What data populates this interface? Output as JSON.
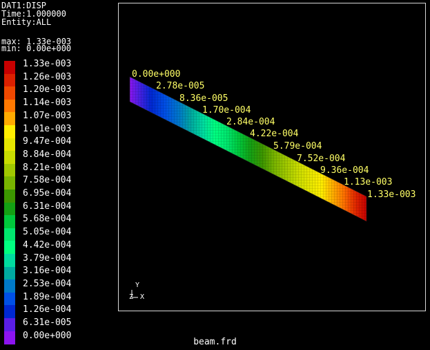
{
  "header": {
    "line1": "DAT1:DISP",
    "line2": "Time:1.000000",
    "line3": "Entity:ALL",
    "max": "max: 1.33e-003",
    "min": "min: 0.00e+000"
  },
  "legend": [
    {
      "label": "1.33e-003",
      "color": "#c80000"
    },
    {
      "label": "1.26e-003",
      "color": "#dc2000"
    },
    {
      "label": "1.20e-003",
      "color": "#f04800"
    },
    {
      "label": "1.14e-003",
      "color": "#ff7800"
    },
    {
      "label": "1.07e-003",
      "color": "#ffaa00"
    },
    {
      "label": "1.01e-003",
      "color": "#ffee00"
    },
    {
      "label": "9.47e-004",
      "color": "#e6e600"
    },
    {
      "label": "8.84e-004",
      "color": "#c8dc00"
    },
    {
      "label": "8.21e-004",
      "color": "#a0c800"
    },
    {
      "label": "7.58e-004",
      "color": "#78b400"
    },
    {
      "label": "6.95e-004",
      "color": "#3c9600"
    },
    {
      "label": "6.31e-004",
      "color": "#14a014"
    },
    {
      "label": "5.68e-004",
      "color": "#00c83c"
    },
    {
      "label": "5.05e-004",
      "color": "#00e66e"
    },
    {
      "label": "4.42e-004",
      "color": "#00ff80"
    },
    {
      "label": "3.79e-004",
      "color": "#00dca0"
    },
    {
      "label": "3.16e-004",
      "color": "#00aaa0"
    },
    {
      "label": "2.53e-004",
      "color": "#007ac8"
    },
    {
      "label": "1.89e-004",
      "color": "#0050e6"
    },
    {
      "label": "1.26e-004",
      "color": "#0028d2"
    },
    {
      "label": "6.31e-005",
      "color": "#5a1ee6"
    },
    {
      "label": "0.00e+000",
      "color": "#8c14f0"
    }
  ],
  "annotations": [
    "0.00e+000",
    "2.78e-005",
    "8.36e-005",
    "1.70e-004",
    "2.84e-004",
    "4.22e-004",
    "5.79e-004",
    "7.52e-004",
    "9.36e-004",
    "1.13e-003",
    "1.33e-003"
  ],
  "axes": {
    "y": "Y",
    "z": "Z",
    "x": "X"
  },
  "filename": "beam.frd"
}
